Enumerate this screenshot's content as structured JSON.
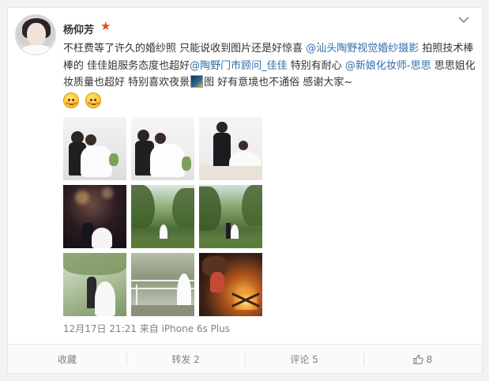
{
  "user": {
    "name": "杨仰芳",
    "verified_icon": "star-icon",
    "verified_color": "#e8461c"
  },
  "post": {
    "segments": [
      {
        "type": "text",
        "value": "不枉费等了许久的婚纱照 只能说收到图片还是好惊喜 "
      },
      {
        "type": "mention",
        "value": "@汕头陶野视觉婚纱摄影"
      },
      {
        "type": "text",
        "value": " 拍照技术棒棒的 佳佳姐服务态度也超好"
      },
      {
        "type": "mention",
        "value": "@陶野门市顾问_佳佳"
      },
      {
        "type": "text",
        "value": " 特别有耐心 "
      },
      {
        "type": "mention",
        "value": "@新娘化妆师-思思"
      },
      {
        "type": "text",
        "value": " 思思姐化妆质量也超好 特别喜欢夜景"
      },
      {
        "type": "inline-image",
        "value": "picture-icon"
      },
      {
        "type": "text",
        "value": "图 好有意境也不通俗 感谢大家~"
      }
    ],
    "emojis": [
      "blush-emoji",
      "shy-emoji"
    ],
    "images": [
      "wedding-photo-1",
      "wedding-photo-2",
      "wedding-photo-3",
      "wedding-photo-night",
      "wedding-photo-forest-1",
      "wedding-photo-forest-2",
      "wedding-photo-garden",
      "wedding-photo-bridge",
      "wedding-photo-fire"
    ]
  },
  "meta": {
    "timestamp": "12月17日 21:21",
    "source_prefix": "来自",
    "device": "iPhone 6s Plus"
  },
  "actions": {
    "favorite_label": "收藏",
    "repost_label": "转发 2",
    "comment_label": "评论 5",
    "like_count": "8"
  },
  "colors": {
    "link": "#2f6fab",
    "meta_text": "#808080",
    "body_text": "#333333"
  }
}
